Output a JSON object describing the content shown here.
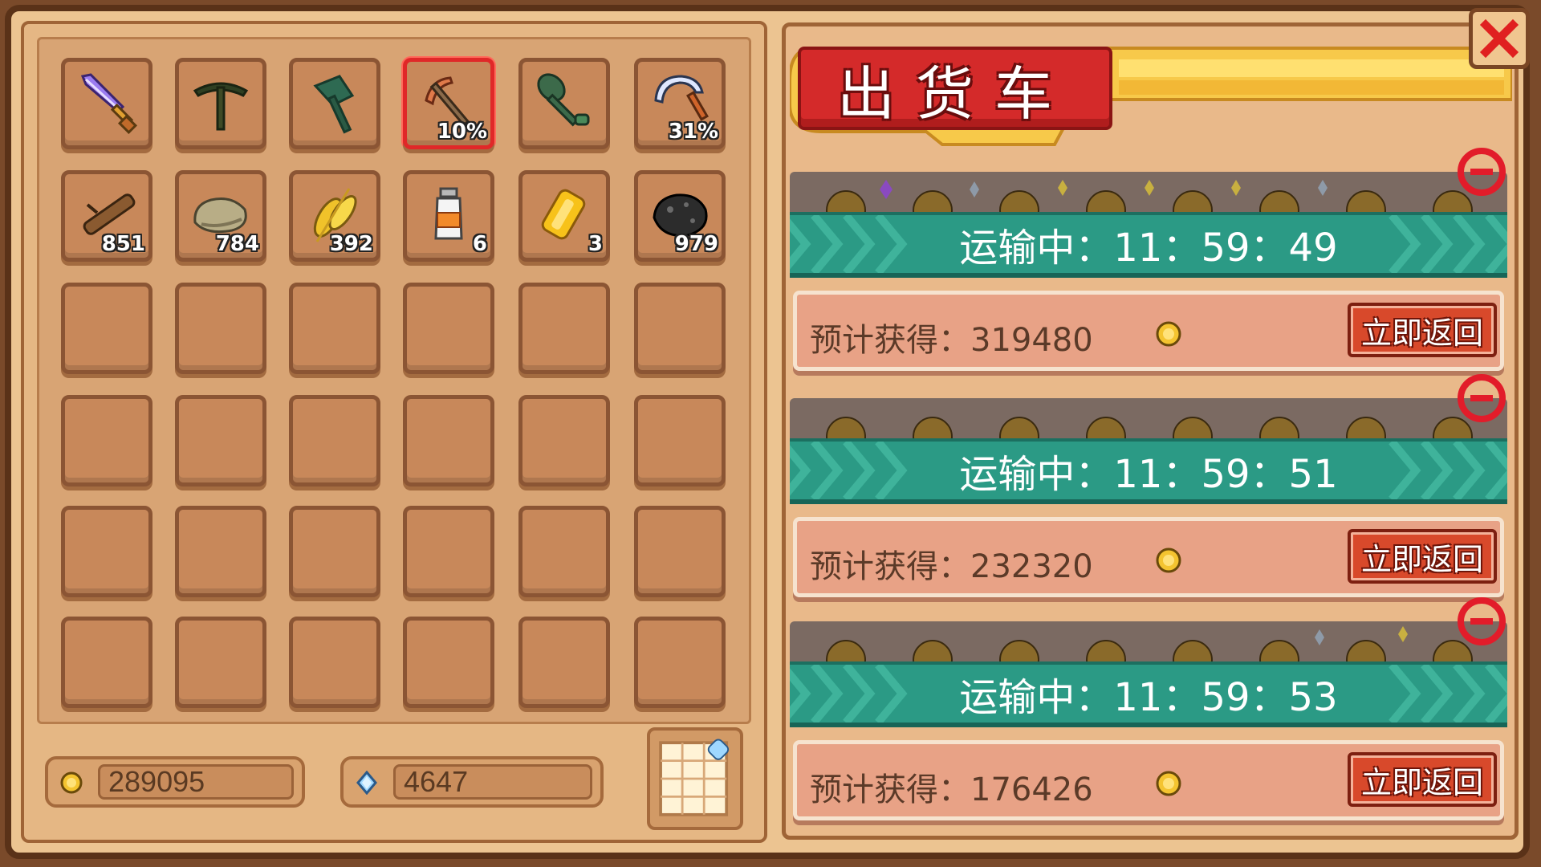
{
  "inventory": {
    "row1": [
      {
        "icon": "purple-sword-icon",
        "badge": ""
      },
      {
        "icon": "pickaxe-icon",
        "badge": ""
      },
      {
        "icon": "axe-icon",
        "badge": ""
      },
      {
        "icon": "hoe-icon",
        "badge": "10%",
        "selected": true
      },
      {
        "icon": "shovel-icon",
        "badge": ""
      },
      {
        "icon": "sickle-icon",
        "badge": "31%"
      }
    ],
    "row2": [
      {
        "icon": "wood-log-icon",
        "badge": "851"
      },
      {
        "icon": "stone-icon",
        "badge": "784"
      },
      {
        "icon": "wheat-icon",
        "badge": "392"
      },
      {
        "icon": "milk-bottle-icon",
        "badge": "6"
      },
      {
        "icon": "gold-bar-icon",
        "badge": "3"
      },
      {
        "icon": "coal-icon",
        "badge": "979"
      }
    ]
  },
  "currency": {
    "gold": "289095",
    "gems": "4647"
  },
  "shipping": {
    "title": "出货车",
    "carts": [
      {
        "status": "运输中：11：59：49",
        "reward_label": "预计获得：319480",
        "button": "立即返回"
      },
      {
        "status": "运输中：11：59：51",
        "reward_label": "预计获得：232320",
        "button": "立即返回"
      },
      {
        "status": "运输中：11：59：53",
        "reward_label": "预计获得：176426",
        "button": "立即返回"
      }
    ]
  },
  "colors": {
    "panel": "#e9b98a",
    "slot": "#c8885a",
    "teal_bar": "#2b9a85",
    "red_title": "#d42a2a",
    "coin": "#f4c430"
  }
}
